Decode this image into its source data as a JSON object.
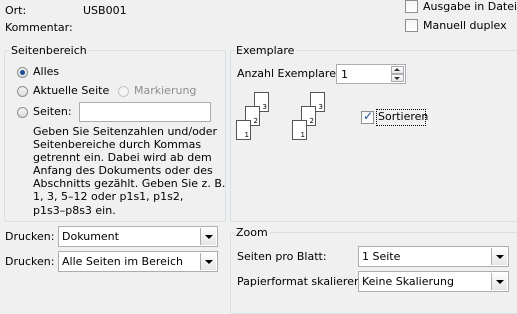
{
  "printer": {
    "ort_label": "Ort:",
    "ort_value": "USB001",
    "kommentar_label": "Kommentar:",
    "ausgabe_in_datei": "Ausgabe in Datei",
    "manuell_duplex": "Manuell duplex"
  },
  "seitenbereich": {
    "title": "Seitenbereich",
    "alles": "Alles",
    "aktuelle_seite": "Aktuelle Seite",
    "markierung": "Markierung",
    "seiten": "Seiten:",
    "seiten_value": "",
    "help": [
      "Geben Sie Seitenzahlen und/oder",
      "Seitenbereiche durch Kommas",
      "getrennt ein. Dabei wird ab dem",
      "Anfang des Dokuments oder des",
      "Abschnitts gezählt. Geben Sie z. B.",
      "1, 3, 5–12 oder p1s1, p1s2,",
      "p1s3–p8s3 ein."
    ]
  },
  "exemplare": {
    "title": "Exemplare",
    "anzahl_label": "Anzahl Exemplare:",
    "anzahl_value": "1",
    "sortieren": "Sortieren",
    "stack_pages": [
      "3",
      "2",
      "1"
    ]
  },
  "drucken": {
    "label1": "Drucken:",
    "value1": "Dokument",
    "label2": "Drucken:",
    "value2": "Alle Seiten im Bereich"
  },
  "zoom": {
    "title": "Zoom",
    "seiten_pro_blatt_label": "Seiten pro Blatt:",
    "seiten_pro_blatt_value": "1 Seite",
    "papierformat_label": "Papierformat skalieren:",
    "papierformat_value": "Keine Skalierung"
  }
}
